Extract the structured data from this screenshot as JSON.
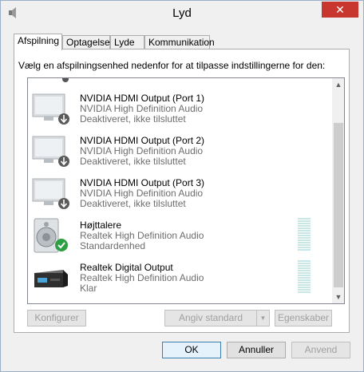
{
  "window": {
    "title": "Lyd",
    "close_label": "✕"
  },
  "tabs": [
    {
      "label": "Afspilning",
      "active": true
    },
    {
      "label": "Optagelse",
      "active": false
    },
    {
      "label": "Lyde",
      "active": false
    },
    {
      "label": "Kommunikation",
      "active": false
    }
  ],
  "panel": {
    "instruction": "Vælg en afspilningsenhed nedenfor for at tilpasse indstillingerne for den:"
  },
  "devices": [
    {
      "name": "NVIDIA HDMI Output (Port 1)",
      "driver": "NVIDIA High Definition Audio",
      "status": "Deaktiveret, ikke tilsluttet",
      "icon": "monitor-disabled-icon"
    },
    {
      "name": "NVIDIA HDMI Output (Port 2)",
      "driver": "NVIDIA High Definition Audio",
      "status": "Deaktiveret, ikke tilsluttet",
      "icon": "monitor-disabled-icon"
    },
    {
      "name": "NVIDIA HDMI Output (Port 3)",
      "driver": "NVIDIA High Definition Audio",
      "status": "Deaktiveret, ikke tilsluttet",
      "icon": "monitor-disabled-icon"
    },
    {
      "name": "Højttalere",
      "driver": "Realtek High Definition Audio",
      "status": "Standardenhed",
      "icon": "speaker-default-icon"
    },
    {
      "name": "Realtek Digital Output",
      "driver": "Realtek High Definition Audio",
      "status": "Klar",
      "icon": "digital-output-icon"
    }
  ],
  "buttons": {
    "configure": "Konfigurer",
    "set_default": "Angiv standard",
    "properties": "Egenskaber",
    "ok": "OK",
    "cancel": "Annuller",
    "apply": "Anvend"
  },
  "colors": {
    "accent": "#3c7fb1",
    "close": "#c7372f",
    "default_check": "#2ea043"
  }
}
